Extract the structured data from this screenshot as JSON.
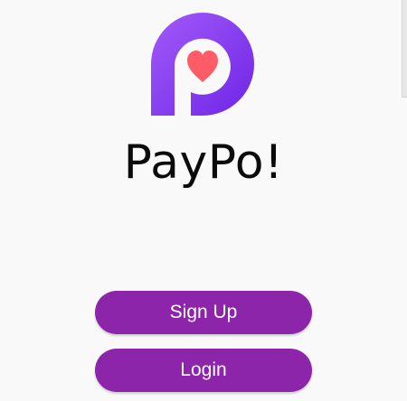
{
  "app": {
    "title": "PayPo!"
  },
  "icons": {
    "logo": "paypo-logo-heart-p",
    "scroll": "scroll-indicator"
  },
  "actions": {
    "signup_label": "Sign Up",
    "login_label": "Login"
  },
  "colors": {
    "background": "#f9f9f9",
    "button": "#8d25aa",
    "button_text": "#ffffff",
    "logo_gradient_start": "#a25bf9",
    "logo_gradient_end": "#6f25e6",
    "heart": "#ff5c67",
    "title": "#0b0b0b"
  }
}
